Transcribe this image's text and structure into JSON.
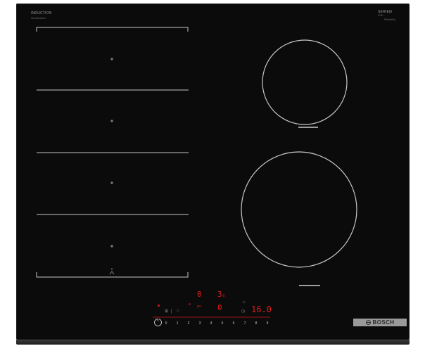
{
  "header": {
    "series_label": "INDUCTION",
    "series_sub": "FlexInduction",
    "model_label": "SERIE|6",
    "model_code": "PXE...",
    "model_sub": "PerfectFry"
  },
  "display": {
    "left_digit": "0",
    "right_digit": "3",
    "right_digit_suffix": "s",
    "middle_digit": "0",
    "timer_value": "16.0",
    "fry_icon": "frying-pan-icon",
    "cook_icon": "pot-icon"
  },
  "scale": {
    "labels": [
      "0",
      "1",
      "2",
      "3",
      "4",
      "5",
      "6",
      "7",
      "8",
      "9"
    ]
  },
  "brand": {
    "name": "BOSCH"
  },
  "colors": {
    "glass": "#0b0b0b",
    "display_red": "#e31b1b",
    "line_grey": "#bdbdbd",
    "brand_plate": "#9a9a9a"
  }
}
